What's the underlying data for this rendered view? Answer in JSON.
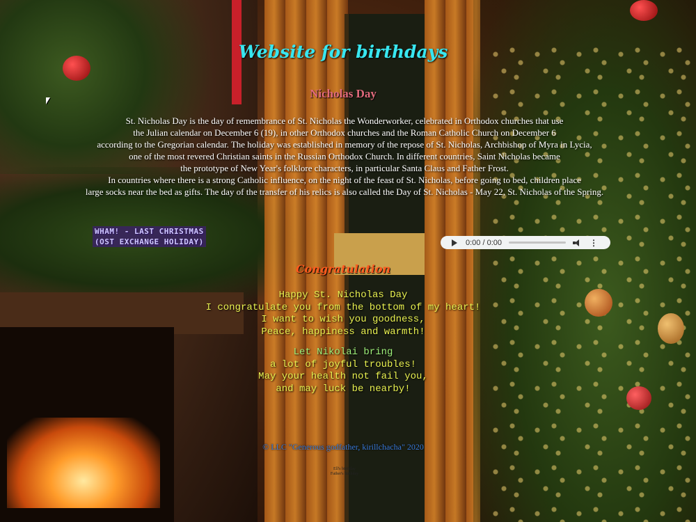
{
  "site_title": "Website for birthdays",
  "holiday": {
    "title": "Nicholas Day",
    "description": [
      "St. Nicholas Day is the day of remembrance of St. Nicholas the Wonderworker, celebrated in Orthodox churches that use",
      "the Julian calendar on December 6 (19), in other Orthodox churches and the Roman Catholic Church on December 6",
      "according to the Gregorian calendar. The holiday was established in memory of the repose of St. Nicholas, Archbishop of Myra in Lycia,",
      "one of the most revered Christian saints in the Russian Orthodox Church. In different countries, Saint Nicholas became",
      "the prototype of New Year's folklore characters, in particular Santa Claus and Father Frost.",
      "In countries where there is a strong Catholic influence, on the night of the feast of St. Nicholas, before going to bed, children place",
      "large socks near the bed as gifts. The day of the transfer of his relics is also called the Day of St. Nicholas - May 22, St. Nicholas of the Spring."
    ]
  },
  "side_link": {
    "line1": "WHAM! - LAST CHRISTMAS",
    "line2": "(OST EXCHANGE HOLIDAY)"
  },
  "audio_player": {
    "time": "0:00 / 0:00",
    "play_icon": "play-icon",
    "volume_icon": "volume-icon",
    "more_icon": "more-options-icon"
  },
  "congratulation": {
    "title": "Congratulation",
    "stanza1": [
      "Happy St. Nicholas Day",
      "I congratulate you from the bottom of my heart!",
      "I want to wish you goodness,",
      "Peace, happiness and warmth!"
    ],
    "stanza2": [
      "Let Nikolai bring",
      "a lot of joyful troubles!",
      "May your health not fail you,",
      "and may luck be nearby!"
    ]
  },
  "footer": {
    "copyright": "© LLC \"Generous godfather, kirillchacha\" 2020",
    "tiny_line1": "Ell's birthday",
    "tiny_line2": "Father's birthday"
  },
  "colors": {
    "title": "#38e6f0",
    "holiday_title": "#e06a7c",
    "congrats_title": "#ff5a1e",
    "poem": "#e8f050",
    "poem_alt": "#9ef07a",
    "copyright": "#3a7ad8"
  }
}
